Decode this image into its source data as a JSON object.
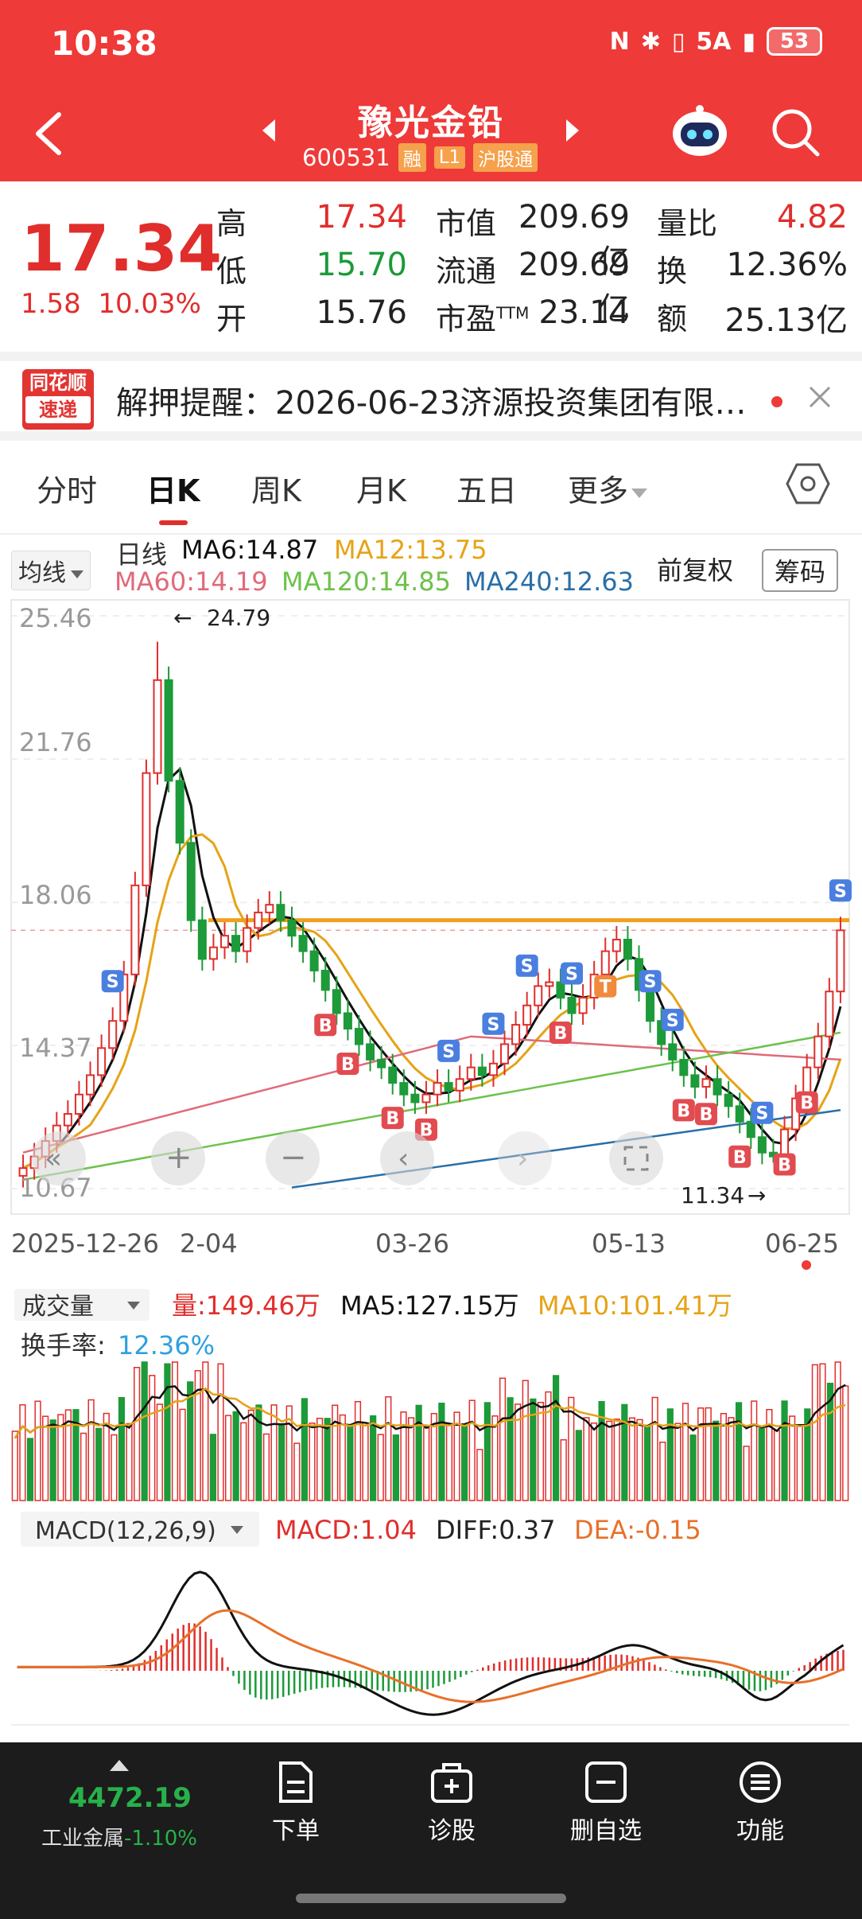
{
  "status": {
    "time": "10:38",
    "network": "5A",
    "battery": "53"
  },
  "header": {
    "title": "豫光金铅",
    "code": "600531",
    "tags": [
      "融",
      "L1",
      "沪股通"
    ]
  },
  "quote": {
    "price": "17.34",
    "change": "1.58",
    "change_pct": "10.03%",
    "labels": {
      "high": "高",
      "low": "低",
      "open": "开",
      "mktcap": "市值",
      "float": "流通",
      "pe": "市盈",
      "pe_sup": "TTM",
      "vol_ratio": "量比",
      "turnover": "换",
      "amount": "额"
    },
    "values": {
      "high": "17.34",
      "low": "15.70",
      "open": "15.76",
      "mktcap": "209.69亿",
      "float": "209.69亿",
      "pe": "23.14",
      "vol_ratio": "4.82",
      "turnover": "12.36%",
      "amount": "25.13亿"
    }
  },
  "notice": {
    "logo_top": "同花顺",
    "logo_bottom": "速递",
    "text": "解押提醒：2026-06-23济源投资集团有限…"
  },
  "tabs": [
    "分时",
    "日K",
    "周K",
    "月K",
    "五日",
    "更多"
  ],
  "ma_legend": {
    "selector": "均线",
    "line_label": "日线",
    "ma6": "MA6:14.87",
    "ma12": "MA12:13.75",
    "ma60": "MA60:14.19",
    "ma120": "MA120:14.85",
    "ma240": "MA240:12.63",
    "adjust": "前复权",
    "chips": "筹码"
  },
  "colors": {
    "up": "#e02e2c",
    "down": "#1d9a39",
    "ma6": "#111111",
    "ma12": "#e6a317",
    "ma60": "#e06a7a",
    "ma120": "#6cc24a",
    "ma240": "#2a6fa8",
    "resistance": "#f0a020"
  },
  "chart_data": [
    {
      "type": "candlestick",
      "ylim": [
        10.67,
        25.46
      ],
      "y_ticks": [
        "25.46",
        "21.76",
        "18.06",
        "14.37",
        "10.67"
      ],
      "x_ticks": [
        "2025-12-26",
        "2-04",
        "03-26",
        "05-13",
        "06-25"
      ],
      "annotations": {
        "high": "24.79",
        "low": "11.34",
        "buy_marker": "B",
        "sell_marker": "S",
        "t_marker": "T"
      },
      "resistance_level": 17.6,
      "closes": [
        11.2,
        11.5,
        11.9,
        12.3,
        12.6,
        13.1,
        13.6,
        14.3,
        15.0,
        16.2,
        18.5,
        21.4,
        23.8,
        21.2,
        19.6,
        17.6,
        16.6,
        16.9,
        17.2,
        16.8,
        17.4,
        17.8,
        18.0,
        17.6,
        17.2,
        16.8,
        16.3,
        15.8,
        15.2,
        14.8,
        14.4,
        14.0,
        13.8,
        13.4,
        13.1,
        12.9,
        13.1,
        13.4,
        13.2,
        13.5,
        13.8,
        13.6,
        13.9,
        14.4,
        14.9,
        15.4,
        15.9,
        16.0,
        15.6,
        15.2,
        15.6,
        16.2,
        16.8,
        17.1,
        16.6,
        15.8,
        15.0,
        14.4,
        14.0,
        13.6,
        13.3,
        13.5,
        13.1,
        12.8,
        12.4,
        12.0,
        11.6,
        11.5,
        12.2,
        13.0,
        13.8,
        14.6,
        15.76,
        17.34
      ]
    },
    {
      "type": "bar",
      "title": "成交量",
      "legend": {
        "vol": "量:149.46万",
        "ma5": "MA5:127.15万",
        "ma10": "MA10:101.41万"
      },
      "turnover_label": "换手率:",
      "turnover_value": "12.36%"
    },
    {
      "type": "line",
      "title": "MACD(12,26,9)",
      "legend": {
        "macd": "MACD:1.04",
        "diff": "DIFF:0.37",
        "dea": "DEA:-0.15"
      }
    }
  ],
  "bottom": {
    "index_value": "4472.19",
    "index_name": "工业金属",
    "index_change": "-1.10%",
    "nav": [
      "下单",
      "诊股",
      "删自选",
      "功能"
    ]
  }
}
